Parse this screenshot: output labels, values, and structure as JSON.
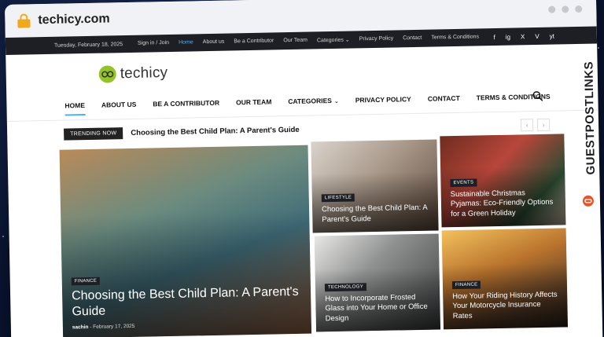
{
  "browser": {
    "url": "techicy.com"
  },
  "topbar": {
    "date": "Tuesday, February 18, 2025",
    "links": [
      "Sign in / Join",
      "Home",
      "About us",
      "Be a Contributor",
      "Our Team",
      "Categories",
      "Privacy Policy",
      "Contact",
      "Terms & Conditions"
    ],
    "social": [
      "f",
      "ig",
      "X",
      "V",
      "yt"
    ]
  },
  "site": {
    "logo_text": "techicy"
  },
  "nav": {
    "items": [
      "HOME",
      "ABOUT US",
      "BE A CONTRIBUTOR",
      "OUR TEAM",
      "CATEGORIES",
      "PRIVACY POLICY",
      "CONTACT",
      "TERMS & CONDITIONS"
    ],
    "caret": "⌄"
  },
  "trending": {
    "badge": "TRENDING NOW",
    "headline": "Choosing the Best Child Plan: A Parent's Guide",
    "prev": "‹",
    "next": "›"
  },
  "cards": [
    {
      "category": "FINANCE",
      "title": "Choosing the Best Child Plan: A Parent's Guide",
      "author": "sachin",
      "date": "February 17, 2025"
    },
    {
      "category": "LIFESTYLE",
      "title": "Choosing the Best Child Plan: A Parent's Guide"
    },
    {
      "category": "EVENTS",
      "title": "Sustainable Christmas Pyjamas: Eco-Friendly Options for a Green Holiday"
    },
    {
      "category": "TECHNOLOGY",
      "title": "How to Incorporate Frosted Glass into Your Home or Office Design"
    },
    {
      "category": "FINANCE",
      "title": "How Your Riding History Affects Your Motorcycle Insurance Rates"
    }
  ],
  "watermark": {
    "text": "GUESTPOSTLINKS"
  },
  "colors": {
    "accent": "#4db2ec",
    "logo_green": "#93c22a",
    "dark": "#1e1f24",
    "lock": "#f0a81c"
  }
}
